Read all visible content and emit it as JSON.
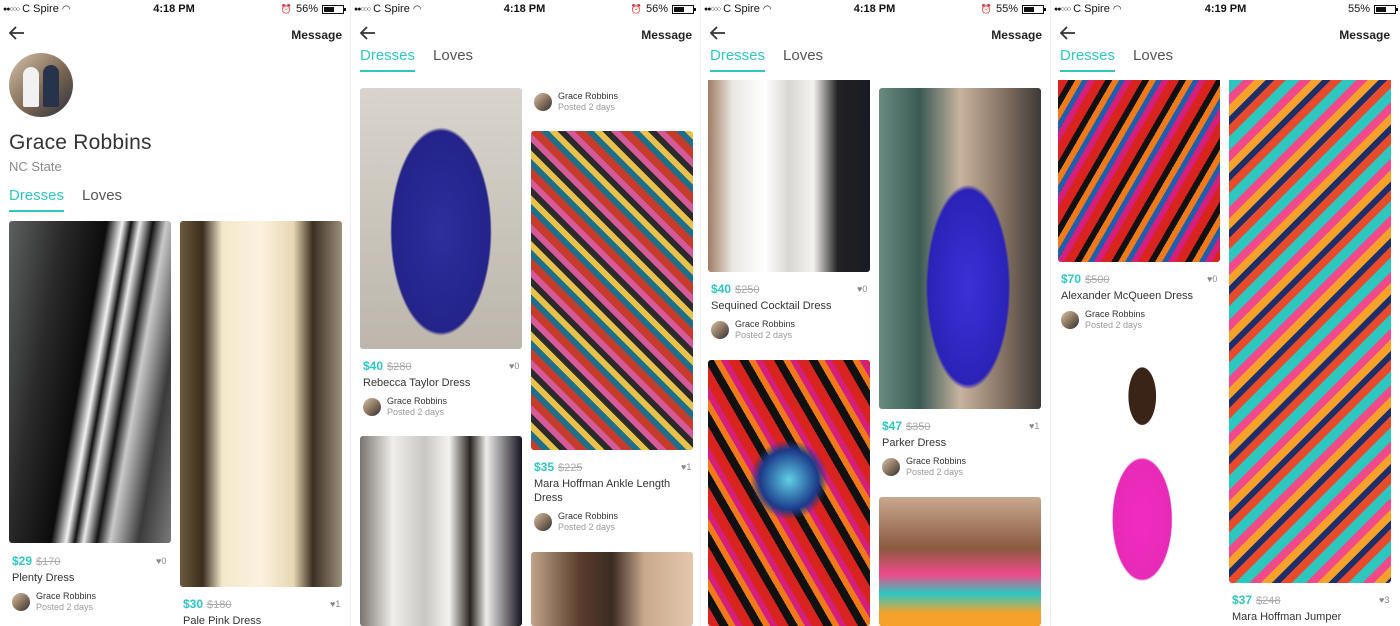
{
  "status_bars": [
    {
      "carrier": "C Spire",
      "time": "4:18 PM",
      "battery": "56%",
      "battery_level": 0.56
    },
    {
      "carrier": "C Spire",
      "time": "4:18 PM",
      "battery": "56%",
      "battery_level": 0.56
    },
    {
      "carrier": "C Spire",
      "time": "4:18 PM",
      "battery": "55%",
      "battery_level": 0.55
    },
    {
      "carrier": "C Spire",
      "time": "4:19 PM",
      "battery": "55%",
      "battery_level": 0.55
    }
  ],
  "nav": {
    "message": "Message"
  },
  "profile": {
    "name": "Grace Robbins",
    "school": "NC State"
  },
  "tabs": {
    "dresses": "Dresses",
    "loves": "Loves"
  },
  "accent_color": "#2ec7c0",
  "items": {
    "plenty": {
      "price": "$29",
      "old_price": "$170",
      "likes": "0",
      "title": "Plenty Dress",
      "seller": "Grace Robbins",
      "posted": "Posted 2 days"
    },
    "pale_pink": {
      "price": "$30",
      "old_price": "$180",
      "likes": "1",
      "title": "Pale Pink Dress"
    },
    "rebecca": {
      "price": "$40",
      "old_price": "$280",
      "likes": "0",
      "title": "Rebecca Taylor Dress",
      "seller": "Grace Robbins",
      "posted": "Posted 2 days"
    },
    "top_seller_s2": {
      "seller": "Grace Robbins",
      "posted": "Posted 2 days"
    },
    "mara_ankle": {
      "price": "$35",
      "old_price": "$225",
      "likes": "1",
      "title": "Mara Hoffman Ankle Length Dress",
      "seller": "Grace Robbins",
      "posted": "Posted 2 days"
    },
    "sequined": {
      "price": "$40",
      "old_price": "$250",
      "likes": "0",
      "title": "Sequined Cocktail Dress",
      "seller": "Grace Robbins",
      "posted": "Posted 2 days"
    },
    "parker": {
      "price": "$47",
      "old_price": "$350",
      "likes": "1",
      "title": "Parker Dress",
      "seller": "Grace Robbins",
      "posted": "Posted 2 days"
    },
    "mcqueen": {
      "price": "$70",
      "old_price": "$500",
      "likes": "0",
      "title": "Alexander McQueen Dress",
      "seller": "Grace Robbins",
      "posted": "Posted 2 days"
    },
    "mara_jumper": {
      "price": "$37",
      "old_price": "$248",
      "likes": "3",
      "title": "Mara Hoffman Jumper"
    }
  },
  "icons": {
    "back": "back-arrow-icon",
    "heart": "heart-icon",
    "wifi": "wifi-icon",
    "alarm": "alarm-icon",
    "battery": "battery-icon"
  }
}
